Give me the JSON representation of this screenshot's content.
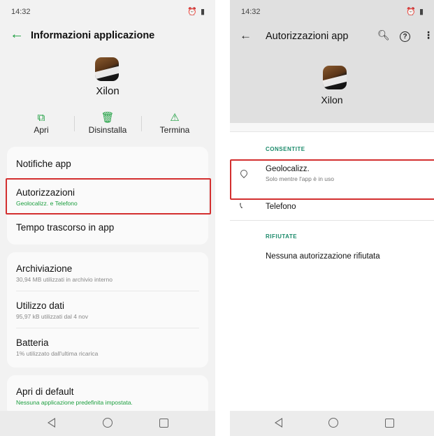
{
  "left": {
    "status": {
      "time": "14:32",
      "icons": "⏰ ▮"
    },
    "header": {
      "title": "Informazioni applicazione"
    },
    "app": {
      "name": "Xilon"
    },
    "actions": [
      {
        "label": "Apri",
        "icon": "open-icon"
      },
      {
        "label": "Disinstalla",
        "icon": "trash-icon"
      },
      {
        "label": "Termina",
        "icon": "warning-icon"
      }
    ],
    "items": {
      "notifiche": {
        "title": "Notifiche app"
      },
      "autorizzazioni": {
        "title": "Autorizzazioni",
        "subtitle": "Geolocalizz. e Telefono"
      },
      "tempo": {
        "title": "Tempo trascorso in app"
      },
      "archiviazione": {
        "title": "Archiviazione",
        "subtitle": "30,94 MB utilizzati in archivio interno"
      },
      "utilizzo": {
        "title": "Utilizzo dati",
        "subtitle": "95,97 kB utilizzati dal 4 nov"
      },
      "batteria": {
        "title": "Batteria",
        "subtitle": "1% utilizzato dall'ultima ricarica"
      },
      "default": {
        "title": "Apri di default",
        "subtitle": "Nessuna applicazione predefinita impostata."
      }
    }
  },
  "right": {
    "status": {
      "time": "14:32",
      "icons": "⏰ ▮"
    },
    "header": {
      "title": "Autorizzazioni app"
    },
    "app": {
      "name": "Xilon"
    },
    "allowed_header": "CONSENTITE",
    "allowed": [
      {
        "title": "Geolocalizz.",
        "subtitle": "Solo mentre l'app è in uso",
        "icon": "location-icon"
      },
      {
        "title": "Telefono",
        "icon": "phone-icon"
      }
    ],
    "denied_header": "RIFIUTATE",
    "denied_text": "Nessuna autorizzazione rifiutata"
  },
  "colors": {
    "accent": "#1b9e3e",
    "highlight": "#d32f2f"
  }
}
